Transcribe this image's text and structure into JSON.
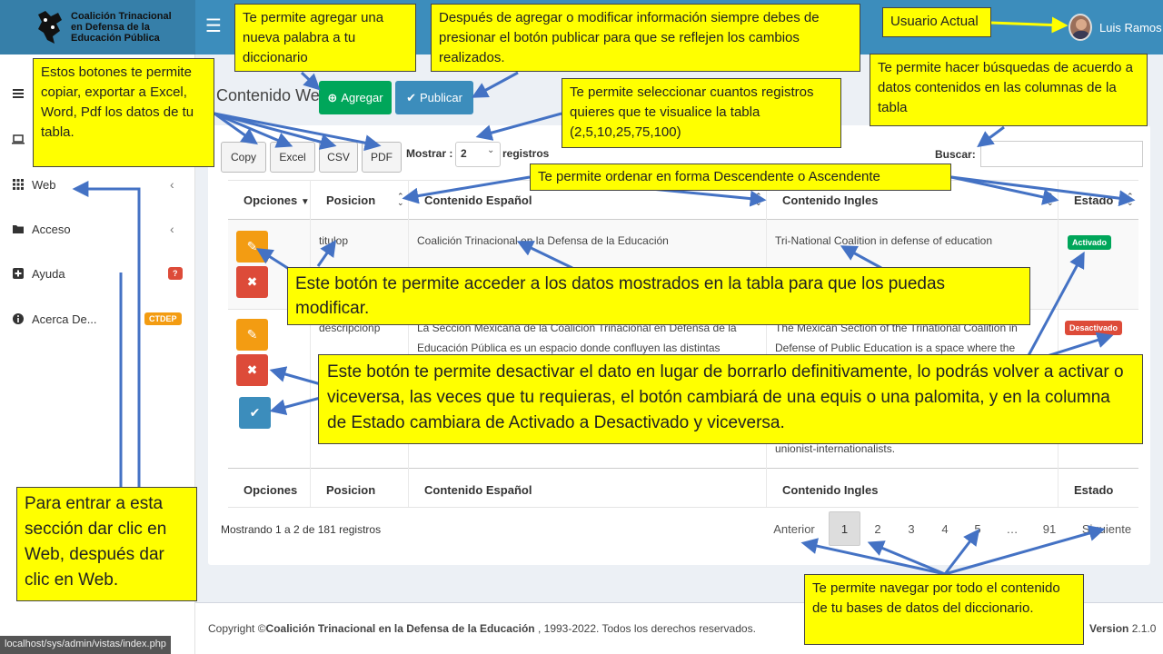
{
  "brand": {
    "name": "Coalición Trinacional en Defensa de la Educación Pública"
  },
  "topbar": {
    "menu_icon": "☰",
    "user_name": "Luis Ramos"
  },
  "sidebar": {
    "items": [
      {
        "label": "Web"
      },
      {
        "label": "Acceso"
      },
      {
        "label": "Ayuda",
        "badge": "?"
      },
      {
        "label": "Acerca De...",
        "badge": "CTDEP"
      }
    ],
    "status_url": "localhost/sys/admin/vistas/index.php"
  },
  "page": {
    "title": "Contenido Web",
    "add_label": "Agregar",
    "publish_label": "Publicar"
  },
  "export_buttons": [
    "Copy",
    "Excel",
    "CSV",
    "PDF"
  ],
  "length": {
    "label": "Mostrar :",
    "value": "2",
    "suffix": "registros"
  },
  "search": {
    "label": "Buscar:"
  },
  "table": {
    "headers": [
      "Opciones",
      "Posicion",
      "Contenido Español",
      "Contenido Ingles",
      "Estado"
    ],
    "rows": [
      {
        "posicion": "titulop",
        "es": "Coalición Trinacional en la Defensa de la Educación",
        "en": "Tri-National Coalition in defense of education",
        "estado": "Activado"
      },
      {
        "posicion": "descripcionp",
        "es_1": "La Sección Mexicana de la Coalición Trinacional en Defensa de la",
        "es_2": "Educación Pública es un espacio donde confluyen las distintas",
        "en_1": "The Mexican Section of the Trinational Coalition in",
        "en_2": "Defense of Public Education is a space where the",
        "en_3": "unionist-internationalists.",
        "estado": "Desactivado"
      }
    ]
  },
  "info": "Mostrando 1 a 2 de 181 registros",
  "pagination": {
    "prev": "Anterior",
    "pages": [
      "1",
      "2",
      "3",
      "4",
      "5",
      "…",
      "91"
    ],
    "next": "Siguiente"
  },
  "footer": {
    "prefix": "Copyright ©",
    "org": "Coalición Trinacional en la Defensa de la Educación",
    "suffix": " , 1993-2022. Todos los derechos reservados.",
    "version_label": "Version",
    "version": "2.1.0"
  },
  "callouts": {
    "agregar": "Te permite agregar una nueva palabra a tu diccionario",
    "publicar": "Después de agregar o modificar información siempre debes de presionar el botón publicar para que se reflejen los cambios realizados.",
    "usuario": "Usuario Actual",
    "exportar": "Estos botones te permite copiar, exportar a Excel, Word, Pdf los datos de tu tabla.",
    "mostrar": "Te permite seleccionar cuantos registros quieres que te visualice la tabla (2,5,10,25,75,100)",
    "buscar": "Te permite hacer búsquedas de acuerdo a datos contenidos en las columnas de la tabla",
    "ordenar": "Te permite ordenar en forma Descendente o Ascendente",
    "editar": "Este botón te permite acceder a los datos mostrados en la tabla para que los puedas modificar.",
    "desactivar": "Este botón te permite desactivar el dato en lugar de borrarlo definitivamente, lo podrás volver a activar o viceversa, las veces que tu requieras, el botón cambiará de una equis o una palomita, y en la columna de Estado cambiara de Activado a Desactivado y viceversa.",
    "web": "Para entrar a esta sección dar clic en Web, después dar clic en Web.",
    "navegar": "Te permite navegar por todo el contenido de tu bases de datos del diccionario."
  }
}
